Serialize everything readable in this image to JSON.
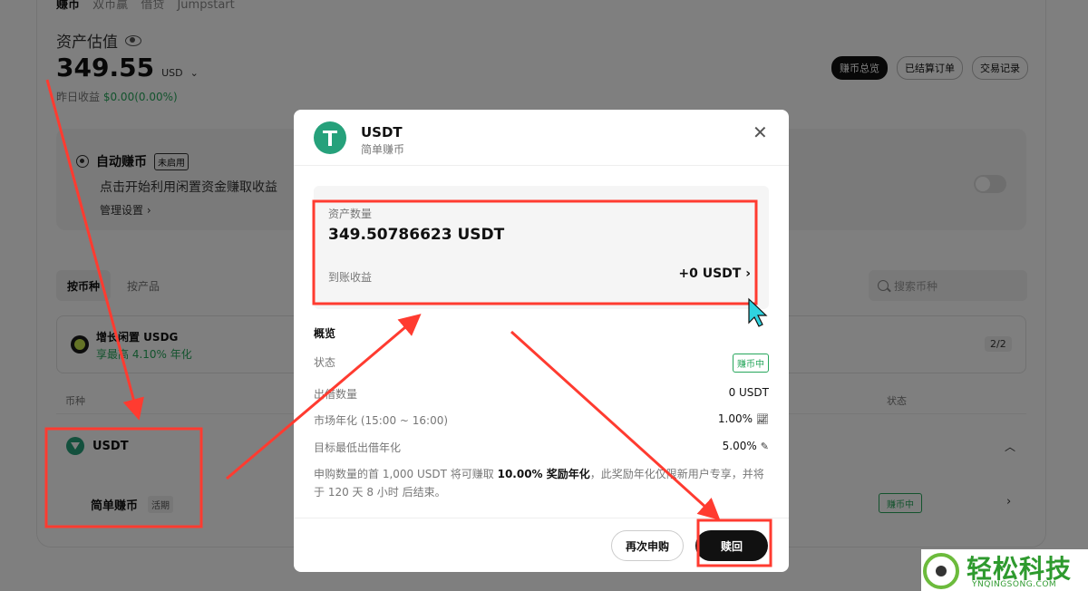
{
  "page": {
    "sub_tabs": [
      "赚币",
      "双币赢",
      "借贷",
      "Jumpstart"
    ],
    "asset_title": "资产估值",
    "asset_value": "349.55",
    "asset_unit": "USD",
    "yesterday_label": "昨日收益",
    "yesterday_value": "$0.00(0.00%)",
    "top_buttons": [
      "赚币总览",
      "已结算订单",
      "交易记录"
    ],
    "auto_earn": {
      "title": "自动赚币",
      "tag": "未启用",
      "desc": "点击开始利用闲置资金赚取收益",
      "link": "管理设置 ›"
    },
    "tabs": [
      "按币种",
      "按产品"
    ],
    "search_placeholder": "搜索币种",
    "promo": {
      "title": "增长闲置 USDG",
      "subtitle": "享最高 4.10% 年化",
      "page_indicator": "2/2"
    },
    "columns": {
      "coin": "币种",
      "status": "状态"
    },
    "row": {
      "coin": "USDT",
      "product": "简单赚币",
      "product_tag": "活期",
      "status": "赚币中"
    }
  },
  "modal": {
    "coin": "USDT",
    "subtitle": "简单赚币",
    "box": {
      "label": "资产数量",
      "value": "349.50786623 USDT",
      "earn_label": "到账收益",
      "earn_value": "+0 USDT"
    },
    "section_title": "概览",
    "rows": [
      {
        "label": "状态",
        "value": "赚币中"
      },
      {
        "label": "出借数量",
        "value": "0 USDT"
      },
      {
        "label": "市场年化 (15:00 ~ 16:00)",
        "value": "1.00%"
      },
      {
        "label": "目标最低出借年化",
        "value": "5.00%"
      }
    ],
    "note": {
      "before": "申购数量的首 1,000 USDT 将可赚取 ",
      "bold": "10.00% 奖励年化",
      "after": "，此奖励年化仅限新用户专享，并将于 120 天 8 小时 后结束。"
    },
    "buttons": {
      "again": "再次申购",
      "redeem": "赎回"
    }
  },
  "annotation_color": "#ff3b30",
  "watermark": {
    "text": "轻松科技",
    "url": "YNQINGSONG.COM"
  }
}
